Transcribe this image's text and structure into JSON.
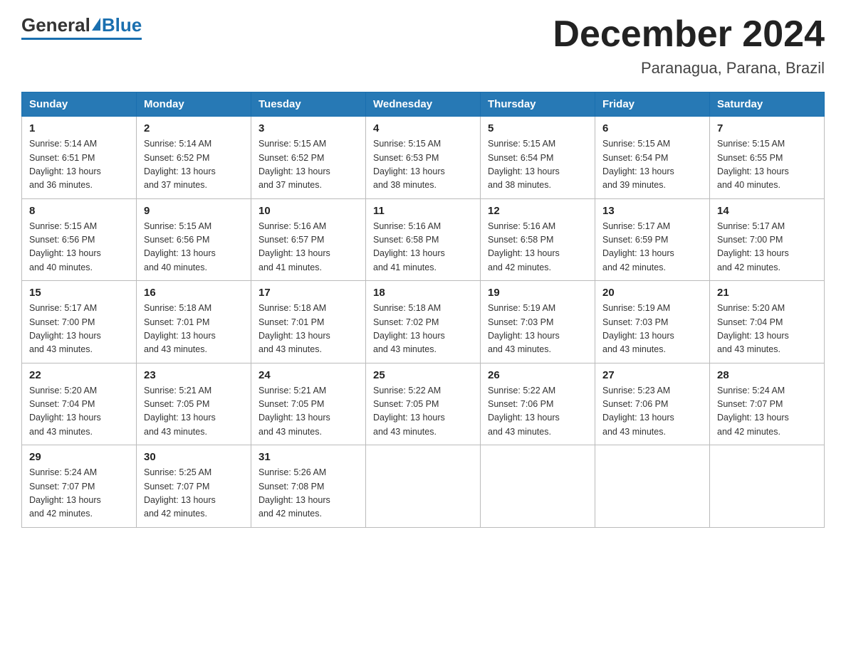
{
  "logo": {
    "text_general": "General",
    "text_blue": "Blue"
  },
  "title": "December 2024",
  "subtitle": "Paranagua, Parana, Brazil",
  "days_of_week": [
    "Sunday",
    "Monday",
    "Tuesday",
    "Wednesday",
    "Thursday",
    "Friday",
    "Saturday"
  ],
  "weeks": [
    [
      {
        "day": "1",
        "sunrise": "5:14 AM",
        "sunset": "6:51 PM",
        "daylight": "13 hours and 36 minutes."
      },
      {
        "day": "2",
        "sunrise": "5:14 AM",
        "sunset": "6:52 PM",
        "daylight": "13 hours and 37 minutes."
      },
      {
        "day": "3",
        "sunrise": "5:15 AM",
        "sunset": "6:52 PM",
        "daylight": "13 hours and 37 minutes."
      },
      {
        "day": "4",
        "sunrise": "5:15 AM",
        "sunset": "6:53 PM",
        "daylight": "13 hours and 38 minutes."
      },
      {
        "day": "5",
        "sunrise": "5:15 AM",
        "sunset": "6:54 PM",
        "daylight": "13 hours and 38 minutes."
      },
      {
        "day": "6",
        "sunrise": "5:15 AM",
        "sunset": "6:54 PM",
        "daylight": "13 hours and 39 minutes."
      },
      {
        "day": "7",
        "sunrise": "5:15 AM",
        "sunset": "6:55 PM",
        "daylight": "13 hours and 40 minutes."
      }
    ],
    [
      {
        "day": "8",
        "sunrise": "5:15 AM",
        "sunset": "6:56 PM",
        "daylight": "13 hours and 40 minutes."
      },
      {
        "day": "9",
        "sunrise": "5:15 AM",
        "sunset": "6:56 PM",
        "daylight": "13 hours and 40 minutes."
      },
      {
        "day": "10",
        "sunrise": "5:16 AM",
        "sunset": "6:57 PM",
        "daylight": "13 hours and 41 minutes."
      },
      {
        "day": "11",
        "sunrise": "5:16 AM",
        "sunset": "6:58 PM",
        "daylight": "13 hours and 41 minutes."
      },
      {
        "day": "12",
        "sunrise": "5:16 AM",
        "sunset": "6:58 PM",
        "daylight": "13 hours and 42 minutes."
      },
      {
        "day": "13",
        "sunrise": "5:17 AM",
        "sunset": "6:59 PM",
        "daylight": "13 hours and 42 minutes."
      },
      {
        "day": "14",
        "sunrise": "5:17 AM",
        "sunset": "7:00 PM",
        "daylight": "13 hours and 42 minutes."
      }
    ],
    [
      {
        "day": "15",
        "sunrise": "5:17 AM",
        "sunset": "7:00 PM",
        "daylight": "13 hours and 43 minutes."
      },
      {
        "day": "16",
        "sunrise": "5:18 AM",
        "sunset": "7:01 PM",
        "daylight": "13 hours and 43 minutes."
      },
      {
        "day": "17",
        "sunrise": "5:18 AM",
        "sunset": "7:01 PM",
        "daylight": "13 hours and 43 minutes."
      },
      {
        "day": "18",
        "sunrise": "5:18 AM",
        "sunset": "7:02 PM",
        "daylight": "13 hours and 43 minutes."
      },
      {
        "day": "19",
        "sunrise": "5:19 AM",
        "sunset": "7:03 PM",
        "daylight": "13 hours and 43 minutes."
      },
      {
        "day": "20",
        "sunrise": "5:19 AM",
        "sunset": "7:03 PM",
        "daylight": "13 hours and 43 minutes."
      },
      {
        "day": "21",
        "sunrise": "5:20 AM",
        "sunset": "7:04 PM",
        "daylight": "13 hours and 43 minutes."
      }
    ],
    [
      {
        "day": "22",
        "sunrise": "5:20 AM",
        "sunset": "7:04 PM",
        "daylight": "13 hours and 43 minutes."
      },
      {
        "day": "23",
        "sunrise": "5:21 AM",
        "sunset": "7:05 PM",
        "daylight": "13 hours and 43 minutes."
      },
      {
        "day": "24",
        "sunrise": "5:21 AM",
        "sunset": "7:05 PM",
        "daylight": "13 hours and 43 minutes."
      },
      {
        "day": "25",
        "sunrise": "5:22 AM",
        "sunset": "7:05 PM",
        "daylight": "13 hours and 43 minutes."
      },
      {
        "day": "26",
        "sunrise": "5:22 AM",
        "sunset": "7:06 PM",
        "daylight": "13 hours and 43 minutes."
      },
      {
        "day": "27",
        "sunrise": "5:23 AM",
        "sunset": "7:06 PM",
        "daylight": "13 hours and 43 minutes."
      },
      {
        "day": "28",
        "sunrise": "5:24 AM",
        "sunset": "7:07 PM",
        "daylight": "13 hours and 42 minutes."
      }
    ],
    [
      {
        "day": "29",
        "sunrise": "5:24 AM",
        "sunset": "7:07 PM",
        "daylight": "13 hours and 42 minutes."
      },
      {
        "day": "30",
        "sunrise": "5:25 AM",
        "sunset": "7:07 PM",
        "daylight": "13 hours and 42 minutes."
      },
      {
        "day": "31",
        "sunrise": "5:26 AM",
        "sunset": "7:08 PM",
        "daylight": "13 hours and 42 minutes."
      },
      null,
      null,
      null,
      null
    ]
  ],
  "labels": {
    "sunrise_prefix": "Sunrise: ",
    "sunset_prefix": "Sunset: ",
    "daylight_prefix": "Daylight: "
  }
}
